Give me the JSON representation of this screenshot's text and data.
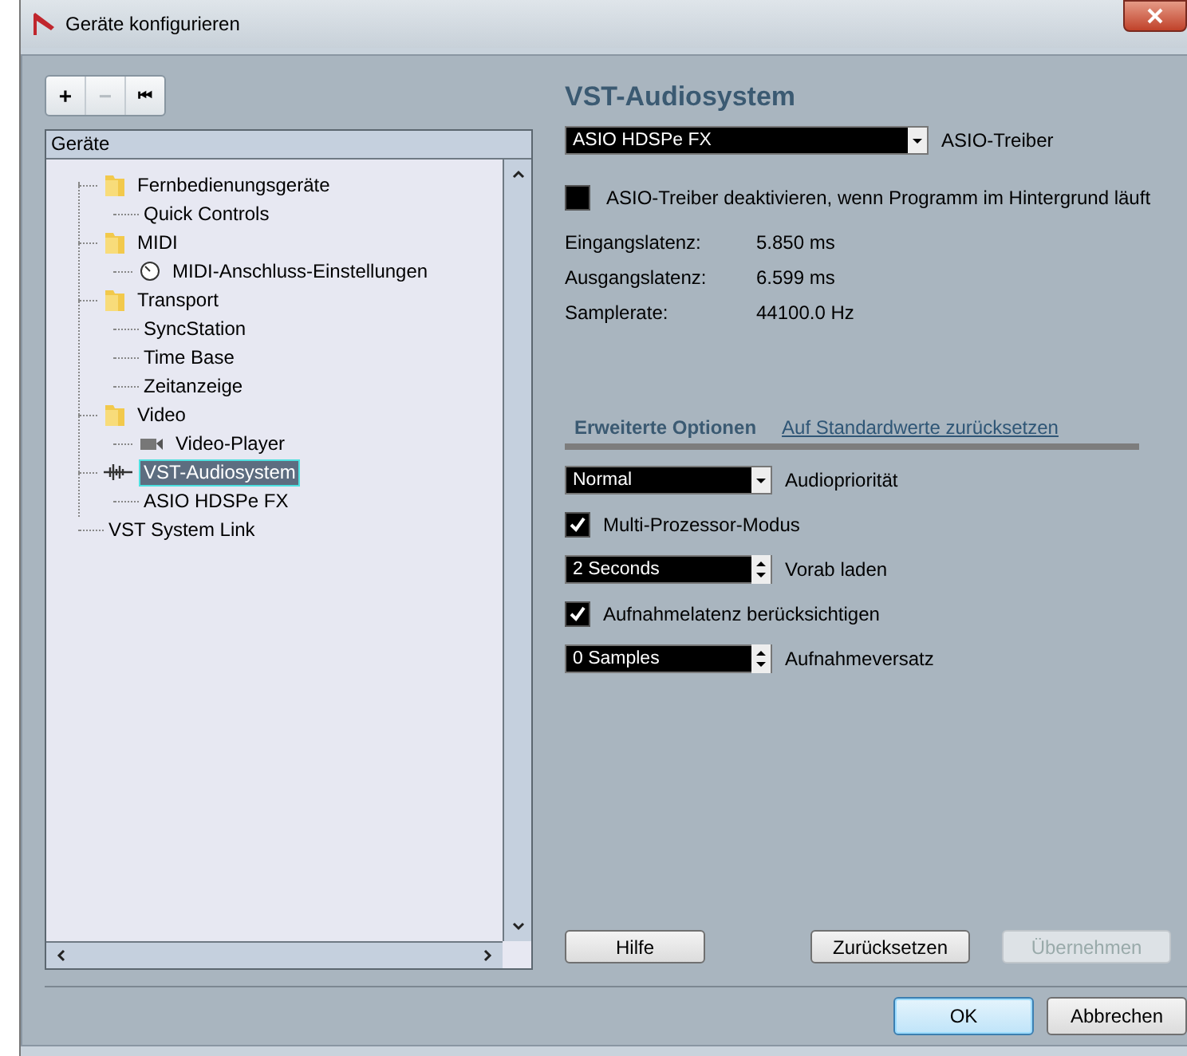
{
  "window": {
    "title": "Geräte konfigurieren"
  },
  "toolbar": {
    "buttons": [
      {
        "label": "+",
        "disabled": false
      },
      {
        "label": "−",
        "disabled": true
      },
      {
        "label": "⏮",
        "disabled": false
      }
    ]
  },
  "tree": {
    "header": "Geräte",
    "items": [
      {
        "label": "Fernbedienungsgeräte",
        "kind": "folder",
        "selected": false,
        "children": [
          {
            "label": "Quick Controls",
            "kind": "none",
            "selected": false
          }
        ]
      },
      {
        "label": "MIDI",
        "kind": "folder",
        "selected": false,
        "children": [
          {
            "label": "MIDI-Anschluss-Einstellungen",
            "kind": "knob",
            "selected": false
          }
        ]
      },
      {
        "label": "Transport",
        "kind": "folder",
        "selected": false,
        "children": [
          {
            "label": "SyncStation",
            "kind": "none",
            "selected": false
          },
          {
            "label": "Time Base",
            "kind": "none",
            "selected": false
          },
          {
            "label": "Zeitanzeige",
            "kind": "none",
            "selected": false
          }
        ]
      },
      {
        "label": "Video",
        "kind": "folder",
        "selected": false,
        "children": [
          {
            "label": "Video-Player",
            "kind": "camera",
            "selected": false
          }
        ]
      },
      {
        "label": "VST-Audiosystem",
        "kind": "wave",
        "selected": true,
        "children": [
          {
            "label": "ASIO HDSPe FX",
            "kind": "none",
            "selected": false
          }
        ]
      },
      {
        "label": "VST System Link",
        "kind": "none",
        "selected": false
      }
    ]
  },
  "panel": {
    "title": "VST-Audiosystem",
    "driver": {
      "value": "ASIO HDSPe FX",
      "label": "ASIO-Treiber"
    },
    "background_option": {
      "label": "ASIO-Treiber deaktivieren, wenn Programm im Hintergrund läuft",
      "checked": false
    },
    "info": [
      {
        "label": "Eingangslatenz:",
        "value": "5.850 ms"
      },
      {
        "label": "Ausgangslatenz:",
        "value": "6.599 ms"
      },
      {
        "label": "Samplerate:",
        "value": "44100.0 Hz"
      }
    ],
    "section": {
      "title": "Erweiterte Optionen",
      "link": "Auf Standardwerte zurücksetzen"
    },
    "options": [
      {
        "kind": "dropdown",
        "setting": "Normal",
        "name": "Audiopriorität"
      },
      {
        "kind": "checkbox",
        "text": "Multi-Prozessor-Modus",
        "checked": true
      },
      {
        "kind": "spinner",
        "setting": "2 Seconds",
        "name": "Vorab laden"
      },
      {
        "kind": "checkbox",
        "text": "Aufnahmelatenz berücksichtigen",
        "checked": true
      },
      {
        "kind": "spinner",
        "setting": "0 Samples",
        "name": "Aufnahmeversatz"
      }
    ],
    "buttons": [
      {
        "label": "Hilfe",
        "disabled": false
      },
      {
        "label": "Zurücksetzen",
        "disabled": false
      },
      {
        "label": "Übernehmen",
        "disabled": true
      }
    ]
  },
  "footer": {
    "buttons": [
      {
        "label": "OK",
        "default": true
      },
      {
        "label": "Abbrechen",
        "default": false
      }
    ]
  }
}
